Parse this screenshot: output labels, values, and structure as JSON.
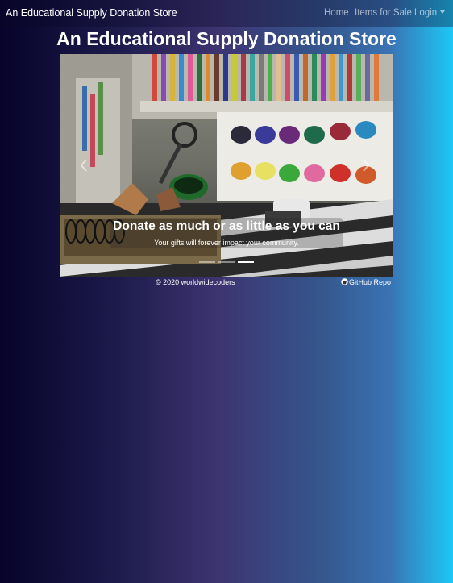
{
  "navbar": {
    "brand": "An Educational Supply Donation Store",
    "links": [
      {
        "label": "Home"
      },
      {
        "label": "Items for Sale"
      },
      {
        "label": "Login"
      }
    ]
  },
  "main": {
    "title": "An Educational Supply Donation Store",
    "carousel": {
      "slide": {
        "image_subject": "art supplies: colored pencils, watercolor paint set, sharpener shavings, spiral notebook",
        "caption_title": "Donate as much or as little as you can",
        "caption_text": "Your gifts will forever impact your community."
      },
      "indicator_count": 3,
      "active_indicator": 2,
      "controls": {
        "prev_icon": "chevron-left-icon",
        "next_icon": "chevron-right-icon"
      }
    }
  },
  "footer": {
    "copyright": "© 2020 worldwidecoders",
    "repo_link": "GitHub Repo",
    "repo_icon": "github-icon"
  },
  "colors": {
    "background_gradient": [
      "#07032a",
      "#3d3470",
      "#35588f",
      "#1cc8f6"
    ],
    "text": "#ffffff"
  }
}
